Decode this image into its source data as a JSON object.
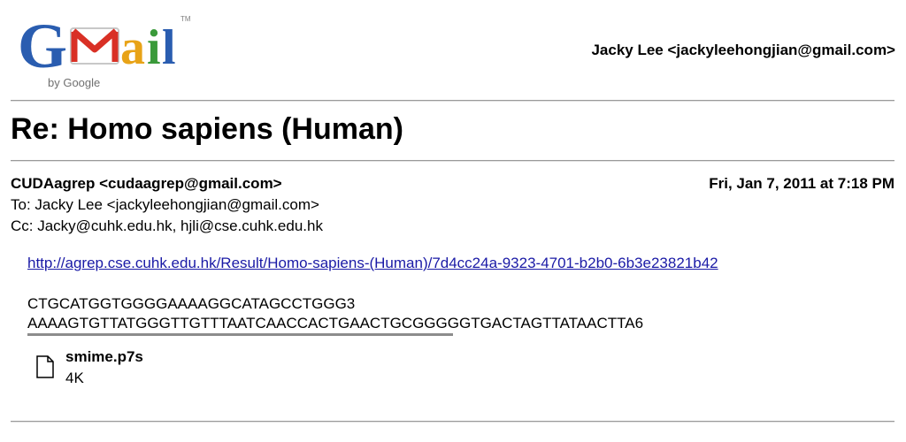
{
  "logo": {
    "wordmark": "Gmail",
    "byline": "by Google",
    "colors": {
      "G": "#2a5db0",
      "m_red": "#d93025",
      "a": "#e8a317",
      "i": "#3a9a3a",
      "l": "#2a5db0"
    }
  },
  "account": {
    "label": "Jacky Lee <jackyleehongjian@gmail.com>"
  },
  "subject": "Re: Homo sapiens (Human)",
  "message": {
    "from": "CUDAagrep <cudaagrep@gmail.com>",
    "date": "Fri, Jan 7, 2011 at 7:18 PM",
    "to": "To: Jacky Lee <jackyleehongjian@gmail.com>",
    "cc": "Cc: Jacky@cuhk.edu.hk, hjli@cse.cuhk.edu.hk",
    "link": "http://agrep.cse.cuhk.edu.hk/Result/Homo-sapiens-(Human)/7d4cc24a-9323-4701-b2b0-6b3e23821b42",
    "sequence_line1": "CTGCATGGTGGGGAAAAGGCATAGCCTGGG3",
    "sequence_line2": "AAAAGTGTTATGGGTTGTTTAATCAACCACTGAACTGCGGGGGTGACTAGTTATAACTTA6"
  },
  "attachment": {
    "name": "smime.p7s",
    "size": "4K",
    "icon": "document-icon"
  }
}
